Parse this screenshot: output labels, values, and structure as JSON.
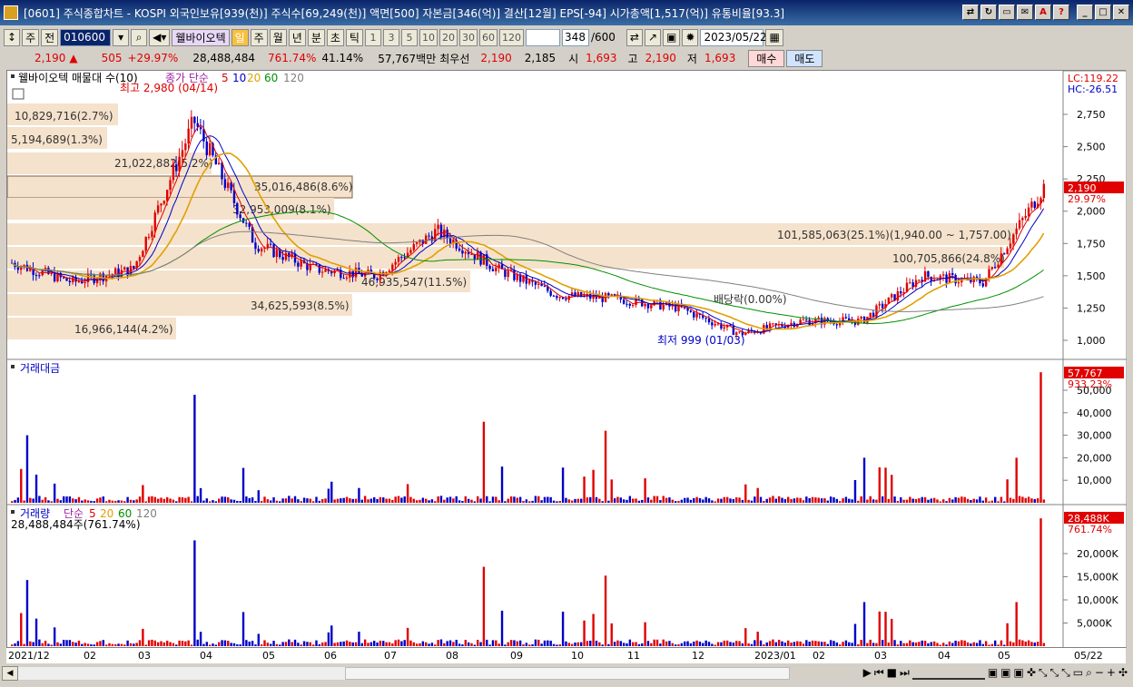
{
  "window": {
    "title": "[0601] 주식종합차트 - KOSPI 외국인보유[939(천)] 주식수[69,249(천)] 액면[500] 자본금[346(억)] 결산[12월] EPS[-94] 시가총액[1,517(억)] 유통비율[93.3]"
  },
  "toolbar": {
    "mode": "주",
    "prev": "전",
    "code": "010600",
    "name": "웰바이오텍",
    "periods": [
      "일",
      "주",
      "월",
      "년",
      "분",
      "초",
      "틱"
    ],
    "active_period": "일",
    "intervals": [
      "1",
      "3",
      "5",
      "10",
      "20",
      "30",
      "60",
      "120"
    ],
    "count": "348",
    "count_total": "/600",
    "date": "2023/05/22"
  },
  "quote": {
    "price": "2,190",
    "change": "505",
    "change_pct": "+29.97%",
    "volume": "28,488,484",
    "volume_pct": "761.74%",
    "turnover": "41.14%",
    "amount": "57,767백만",
    "bid_label": "최우선",
    "bid1": "2,190",
    "bid2": "2,185",
    "open_label": "시",
    "open": "1,693",
    "high_label": "고",
    "high": "2,190",
    "low_label": "저",
    "low": "1,693",
    "buy_button": "매수",
    "sell_button": "매도"
  },
  "price_panel": {
    "legend_name": "웰바이오텍 매물대 수(10)",
    "legend_ma": "종가 단순",
    "legend_periods": [
      "5",
      "10",
      "20",
      "60",
      "120"
    ],
    "lc": "LC:119.22",
    "hc": "HC:-26.51",
    "high_note": "최고 2,980 (04/14)",
    "low_note": "최저 999 (01/03)",
    "rights_note": "배당락(0.00%)",
    "last_price_tag": "2,190",
    "last_pct_tag": "29.97%",
    "yticks": [
      "2,750",
      "2,500",
      "2,250",
      "2,000",
      "1,750",
      "1,500",
      "1,250",
      "1,000"
    ],
    "volume_profile": [
      "10,829,716(2.7%)",
      "5,194,689(1.3%)",
      "21,022,882(5.2%)",
      "35,016,486(8.6%)",
      "32,953,009(8.1%)",
      "101,585,063(25.1%)(1,940.00 ~ 1,757.00)",
      "100,705,866(24.8%)",
      "46,935,547(11.5%)",
      "34,625,593(8.5%)",
      "16,966,144(4.2%)"
    ]
  },
  "amount_panel": {
    "legend": "거래대금",
    "last_tag": "57,767",
    "pct_tag": "933.23%",
    "yticks": [
      "50,000",
      "40,000",
      "30,000",
      "20,000",
      "10,000"
    ]
  },
  "volume_panel": {
    "legend": "거래량",
    "legend_ma": "단순",
    "legend_periods": [
      "5",
      "20",
      "60",
      "120"
    ],
    "value_note": "28,488,484주(761.74%)",
    "last_tag": "28,488K",
    "pct_tag": "761.74%",
    "yticks": [
      "20,000K",
      "15,000K",
      "10,000K",
      "5,000K"
    ]
  },
  "xaxis": {
    "labels": [
      "2021/12",
      "02",
      "03",
      "04",
      "05",
      "06",
      "07",
      "08",
      "09",
      "10",
      "11",
      "12",
      "2023/01",
      "02",
      "03",
      "04",
      "05",
      "05/22"
    ]
  },
  "chart_data": {
    "type": "line",
    "title": "웰바이오텍 일봉",
    "x": [
      "2021/12",
      "02",
      "03",
      "04",
      "05",
      "06",
      "07",
      "08",
      "09",
      "10",
      "11",
      "12",
      "2023/01",
      "02",
      "03",
      "04",
      "05",
      "05/22"
    ],
    "series": [
      {
        "name": "종가",
        "values": [
          1600,
          1450,
          1550,
          2700,
          1750,
          1550,
          1500,
          1850,
          1550,
          1350,
          1320,
          1250,
          1050,
          1150,
          1150,
          1500,
          1450,
          2190
        ]
      }
    ],
    "ylim": [
      950,
      3000
    ]
  }
}
